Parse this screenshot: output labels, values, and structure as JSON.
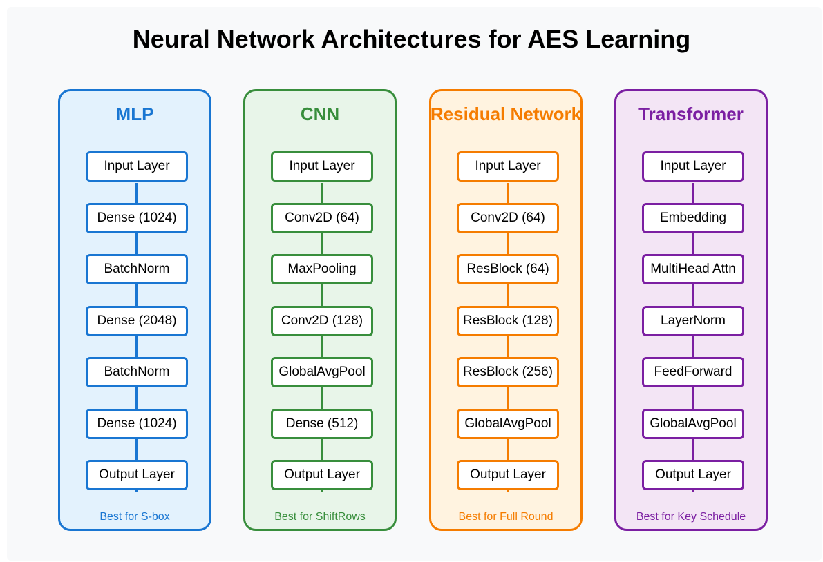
{
  "title": "Neural Network Architectures for AES Learning",
  "columns": [
    {
      "name": "MLP",
      "color": "#1976d2",
      "fill": "#e3f2fd",
      "layers": [
        "Input Layer",
        "Dense (1024)",
        "BatchNorm",
        "Dense (2048)",
        "BatchNorm",
        "Dense (1024)",
        "Output Layer"
      ],
      "note": "Best for S-box"
    },
    {
      "name": "CNN",
      "color": "#388e3c",
      "fill": "#e8f5e9",
      "layers": [
        "Input Layer",
        "Conv2D (64)",
        "MaxPooling",
        "Conv2D (128)",
        "GlobalAvgPool",
        "Dense (512)",
        "Output Layer"
      ],
      "note": "Best for ShiftRows"
    },
    {
      "name": "Residual Network",
      "color": "#f57c00",
      "fill": "#fff3e0",
      "layers": [
        "Input Layer",
        "Conv2D (64)",
        "ResBlock (64)",
        "ResBlock (128)",
        "ResBlock (256)",
        "GlobalAvgPool",
        "Output Layer"
      ],
      "note": "Best for Full Round"
    },
    {
      "name": "Transformer",
      "color": "#7b1fa2",
      "fill": "#f3e5f5",
      "layers": [
        "Input Layer",
        "Embedding",
        "MultiHead Attn",
        "LayerNorm",
        "FeedForward",
        "GlobalAvgPool",
        "Output Layer"
      ],
      "note": "Best for Key Schedule"
    }
  ]
}
